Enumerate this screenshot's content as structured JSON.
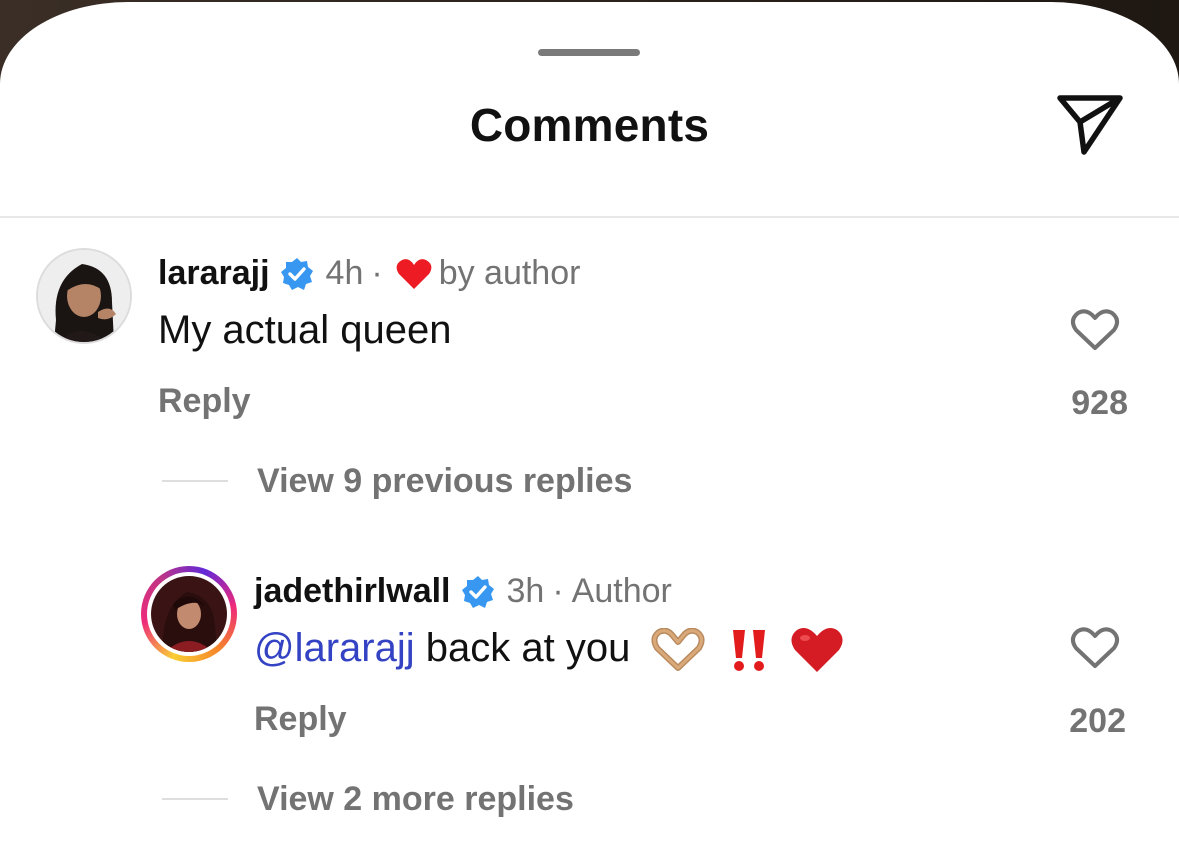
{
  "sheet": {
    "title": "Comments"
  },
  "comments": [
    {
      "username": "lararajj",
      "time": "4h",
      "separator": "·",
      "liked_by_author_label": "by author",
      "text": "My actual queen",
      "reply_label": "Reply",
      "likes": "928",
      "view_replies": "View 9 previous replies"
    },
    {
      "username": "jadethirlwall",
      "time": "3h",
      "separator": "·",
      "author_label": "Author",
      "mention": "@lararajj",
      "text": " back at you",
      "emojis": [
        "heart-hands-emoji",
        "double-exclamation-emoji",
        "red-heart-emoji"
      ],
      "reply_label": "Reply",
      "likes": "202",
      "view_replies": "View 2 more replies"
    }
  ],
  "colors": {
    "accent_blue": "#3897f0",
    "mention": "#3443c4",
    "secondary_text": "#737373",
    "heart_red": "#ed1c24"
  },
  "icons": [
    "send-icon",
    "verified-badge-icon",
    "heart-icon",
    "like-heart-icon"
  ]
}
